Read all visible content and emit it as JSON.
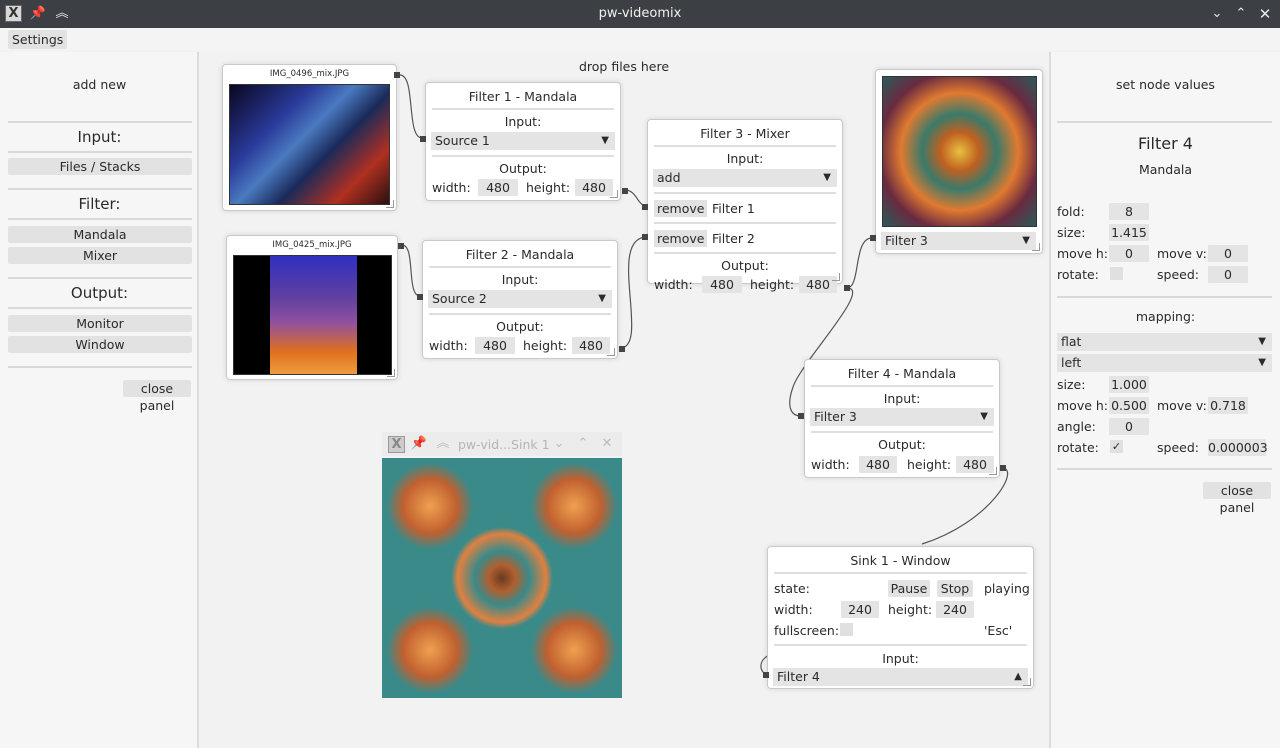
{
  "window": {
    "title": "pw-videomix"
  },
  "menu": {
    "settings": "Settings"
  },
  "left_panel": {
    "add_new": "add new",
    "input_heading": "Input:",
    "input_items": [
      "Files / Stacks"
    ],
    "filter_heading": "Filter:",
    "filter_items": [
      "Mandala",
      "Mixer"
    ],
    "output_heading": "Output:",
    "output_items": [
      "Monitor",
      "Window"
    ],
    "close_panel": "close panel"
  },
  "canvas": {
    "drop_hint": "drop files here",
    "image_nodes": [
      {
        "title": "IMG_0496_mix.JPG"
      },
      {
        "title": "IMG_0425_mix.JPG"
      }
    ],
    "filter1": {
      "title": "Filter 1 - Mandala",
      "input_label": "Input:",
      "input_value": "Source 1",
      "output_label": "Output:",
      "width_label": "width:",
      "width": "480",
      "height_label": "height:",
      "height": "480"
    },
    "filter2": {
      "title": "Filter 2 - Mandala",
      "input_label": "Input:",
      "input_value": "Source 2",
      "output_label": "Output:",
      "width_label": "width:",
      "width": "480",
      "height_label": "height:",
      "height": "480"
    },
    "filter3": {
      "title": "Filter 3 - Mixer",
      "input_label": "Input:",
      "mode": "add",
      "remove_label": "remove",
      "sources": [
        "Filter 1",
        "Filter 2"
      ],
      "output_label": "Output:",
      "width_label": "width:",
      "width": "480",
      "height_label": "height:",
      "height": "480"
    },
    "filter4": {
      "title": "Filter 4 - Mandala",
      "input_label": "Input:",
      "input_value": "Filter 3",
      "output_label": "Output:",
      "width_label": "width:",
      "width": "480",
      "height_label": "height:",
      "height": "480"
    },
    "monitor": {
      "select": "Filter 3"
    },
    "sink": {
      "title": "Sink 1 - Window",
      "state_label": "state:",
      "pause": "Pause",
      "stop": "Stop",
      "status": "playing",
      "width_label": "width:",
      "width": "240",
      "height_label": "height:",
      "height": "240",
      "fullscreen_label": "fullscreen:",
      "esc_hint": "'Esc'",
      "input_label": "Input:",
      "input_value": "Filter 4"
    },
    "float_window": {
      "title": "pw-vid...Sink 1"
    }
  },
  "right_panel": {
    "heading": "set node values",
    "node_title": "Filter 4",
    "node_type": "Mandala",
    "fold_label": "fold:",
    "fold": "8",
    "size_label": "size:",
    "size": "1.415",
    "move_h_label": "move h:",
    "move_h": "0",
    "move_v_label": "move v:",
    "move_v": "0",
    "rotate_label": "rotate:",
    "speed_label": "speed:",
    "speed": "0",
    "mapping_label": "mapping:",
    "mapping_mode": "flat",
    "mapping_side": "left",
    "map_size_label": "size:",
    "map_size": "1.000",
    "map_move_h_label": "move h:",
    "map_move_h": "0.500",
    "map_move_v_label": "move v:",
    "map_move_v": "0.718",
    "angle_label": "angle:",
    "angle": "0",
    "map_rotate_label": "rotate:",
    "map_rotate_check": "✓",
    "map_speed_label": "speed:",
    "map_speed": "0.000003",
    "close_panel": "close panel"
  }
}
